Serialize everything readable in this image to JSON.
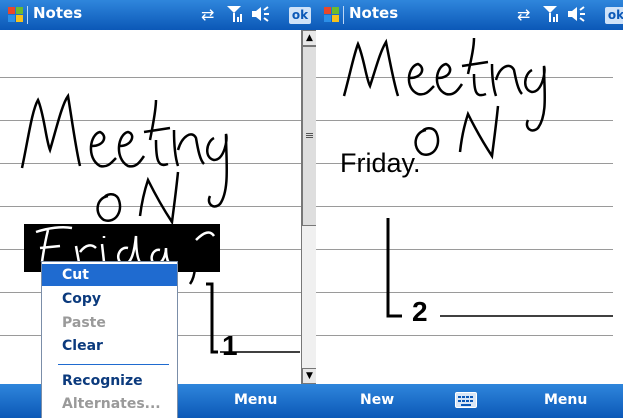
{
  "left_screen": {
    "title": "Notes",
    "ok_label": "ok",
    "softkeys": {
      "right": "Menu"
    },
    "context_menu": [
      {
        "label": "Cut",
        "selected": true,
        "enabled": true
      },
      {
        "label": "Copy",
        "selected": false,
        "enabled": true
      },
      {
        "label": "Paste",
        "selected": false,
        "enabled": false
      },
      {
        "label": "Clear",
        "selected": false,
        "enabled": true
      },
      {
        "label": "Recognize",
        "selected": false,
        "enabled": true
      },
      {
        "label": "Alternates...",
        "selected": false,
        "enabled": false
      }
    ],
    "callout": "1"
  },
  "right_screen": {
    "title": "Notes",
    "ok_label": "ok",
    "recognized_text": "Friday.",
    "softkeys": {
      "left": "New",
      "right": "Menu"
    },
    "callout": "2"
  },
  "icons": [
    "windows-start-icon",
    "connectivity-icon",
    "signal-icon",
    "speaker-icon",
    "keyboard-icon",
    "scroll-up-icon",
    "scroll-down-icon"
  ],
  "colors": {
    "titlebar": "#0b58b7",
    "selection": "#1f6bd0",
    "ink": "#000000"
  }
}
